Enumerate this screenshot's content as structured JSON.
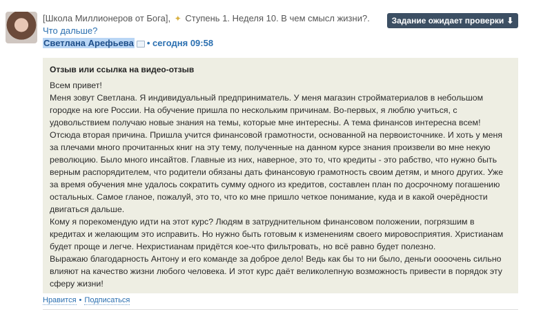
{
  "post": {
    "group": "[Школа Миллионеров от Бога],",
    "step_text": "Ступень 1. Неделя 10. В чем смысл жизни?.",
    "more_link": "Что дальше?",
    "author": "Светлана Арефьева",
    "time_separator": "•",
    "time": "сегодня 09:58"
  },
  "task_button": {
    "label": "Задание ожидает проверки",
    "arrow": "⬇"
  },
  "review": {
    "title": "Отзыв или ссылка на видео-отзыв",
    "paragraphs": [
      "Всем привет!",
      "Меня зовут Светлана. Я индивидуальный предприниматель. У меня магазин стройматериалов в небольшом городке на юге России. На обучение пришла по нескольким причинам. Во-первых, я люблю учиться, с удовольствием получаю новые знания на темы, которые мне интересны. А тема финансов интересна всем! Отсюда вторая причина. Пришла учится финансовой грамотности, основанной на первоисточнике. И хоть у меня за плечами много прочитанных книг на эту тему, полученные на данном курсе знания произвели во мне некую революцию. Было много инсайтов. Главные из них, наверное, это то, что кредиты - это рабство, что нужно быть верным распорядителем, что родители обязаны дать финансовую грамотность своим детям, и много других. Уже за время обучения мне удалось сократить сумму одного из кредитов, составлен план по досрочному погашению остальных. Самое гланое, пожалуй, это то, что ко мне пришло четкое понимание, куда и в какой очерёдности двигаться дальше.",
      "Кому я порекомендую идти на этот курс? Людям в затруднительном финансовом положении, погрязшим в кредитах и желающим это исправить. Но нужно быть готовым к изменениям своего мировосприятия. Христианам будет проще и легче. Нехристианам придётся кое-что фильтровать, но всё равно будет полезно.",
      "Выражаю благодарность Антону и его команде за доброе дело! Ведь как бы то ни было, деньги оооочень сильно влияют на качество жизни любого человека. И этот курс даёт великолепную возможность привести в порядок эту сферу жизни!"
    ]
  },
  "actions": {
    "like": "Нравится",
    "separator": "•",
    "subscribe": "Подписаться"
  },
  "colors": {
    "accent": "#2a6fb0",
    "button_bg": "#3c4f63",
    "review_bg": "#eeeee3",
    "author_highlight": "#b9d6f5"
  }
}
